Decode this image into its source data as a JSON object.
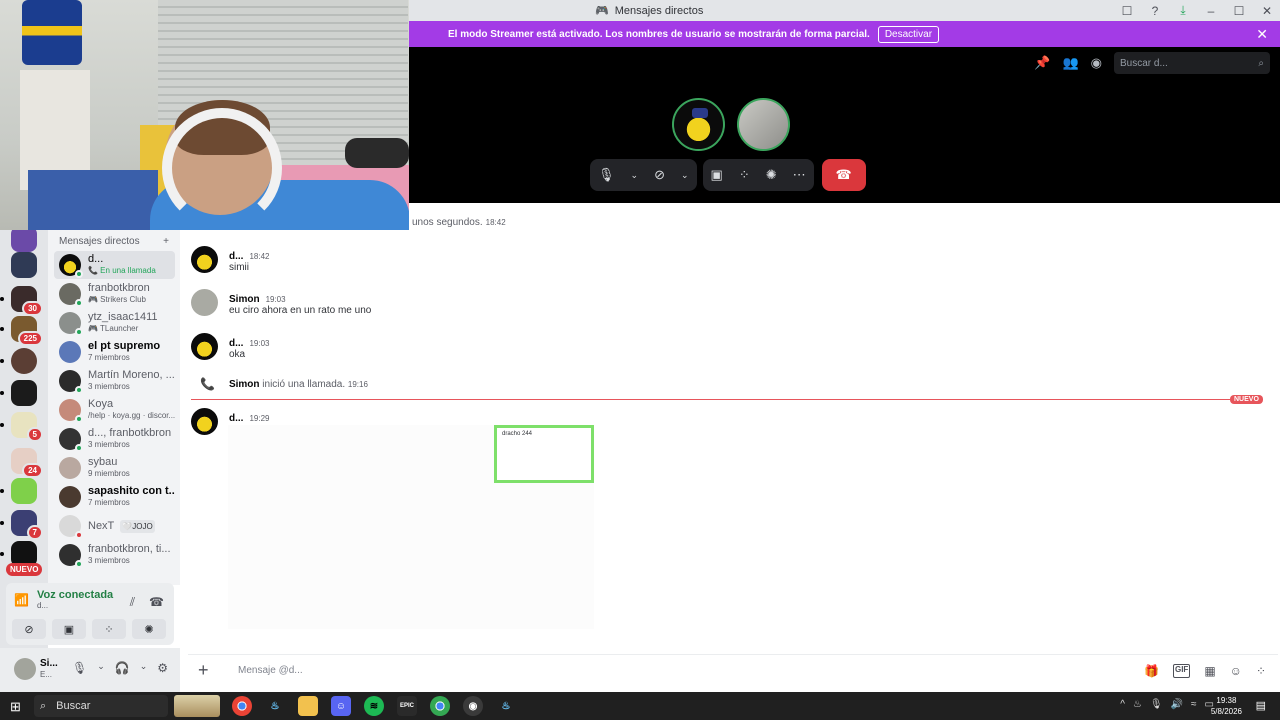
{
  "window": {
    "title": "Mensajes directos",
    "controls": [
      "☐",
      "?",
      "⤓",
      "–",
      "☐",
      "✕"
    ]
  },
  "banner": {
    "text": "El modo Streamer está activado. Los nombres de usuario se mostrarán de forma parcial.",
    "button": "Desactivar",
    "close": "✕"
  },
  "call": {
    "search_placeholder": "Buscar d...",
    "participants": [
      "bart-avatar",
      "simon-avatar"
    ],
    "controls": [
      "mic",
      "camera-off",
      "screen-share",
      "activities",
      "soundboard",
      "more"
    ]
  },
  "servers": [
    {
      "badge": ""
    },
    {
      "badge": ""
    },
    {
      "badge": "30"
    },
    {
      "badge": "225"
    },
    {
      "badge": ""
    },
    {
      "badge": ""
    },
    {
      "badge": "5"
    },
    {
      "badge": "24"
    },
    {
      "badge": ""
    },
    {
      "badge": "7"
    },
    {
      "badge": ""
    }
  ],
  "rail_new_label": "NUEVO",
  "dm_list": {
    "header": "Mensajes directos",
    "add": "+",
    "items": [
      {
        "name": "d...",
        "status": "📞 En una llamada",
        "bold": false,
        "active": true
      },
      {
        "name": "franbotkbron",
        "status": "🎮 Strikers Club",
        "bold": false,
        "active": false
      },
      {
        "name": "ytz_isaac1411",
        "status": "🎮 TLauncher",
        "bold": false,
        "active": false
      },
      {
        "name": "el pt supremo",
        "status": "7 miembros",
        "bold": true,
        "active": false
      },
      {
        "name": "Martín Moreno, ...",
        "status": "3 miembros",
        "bold": false,
        "active": false
      },
      {
        "name": "Koya",
        "status": "/help · koya.gg · discor...",
        "bold": false,
        "active": false
      },
      {
        "name": "d..., franbotkbron",
        "status": "3 miembros",
        "bold": false,
        "active": false
      },
      {
        "name": "sybau",
        "status": "9 miembros",
        "bold": false,
        "active": false
      },
      {
        "name": "sapashito con t...",
        "status": "7 miembros",
        "bold": true,
        "active": false
      },
      {
        "name": "NexT",
        "status": "",
        "bold": false,
        "active": false,
        "tag": "🤍JOJO"
      },
      {
        "name": "franbotkbron, ti...",
        "status": "3 miembros",
        "bold": false,
        "active": false
      }
    ]
  },
  "voice": {
    "title": "Voz conectada",
    "sub": "d..."
  },
  "user": {
    "name": "Si...",
    "status": "E..."
  },
  "chat": {
    "previous_text": "unos segundos.",
    "previous_time": "18:42",
    "messages": [
      {
        "author": "d...",
        "time": "18:42",
        "text": "simii"
      },
      {
        "author": "Simon",
        "time": "19:03",
        "text": "eu ciro ahora en un rato me uno"
      },
      {
        "author": "d...",
        "time": "19:03",
        "text": "oka"
      }
    ],
    "system": {
      "author": "Simon",
      "text": "inició una llamada.",
      "time": "19:16"
    },
    "new_label": "NUEVO",
    "last": {
      "author": "d...",
      "time": "19:29",
      "embed_text": "dracho 244"
    },
    "composer_placeholder": "Mensaje @d..."
  },
  "taskbar": {
    "search": "Buscar",
    "time": "19:38",
    "date": "5/8/2026"
  },
  "colors": {
    "banner": "#a33be6",
    "hangup": "#da373c",
    "online": "#23a55a",
    "new_divider": "#e7555b"
  }
}
